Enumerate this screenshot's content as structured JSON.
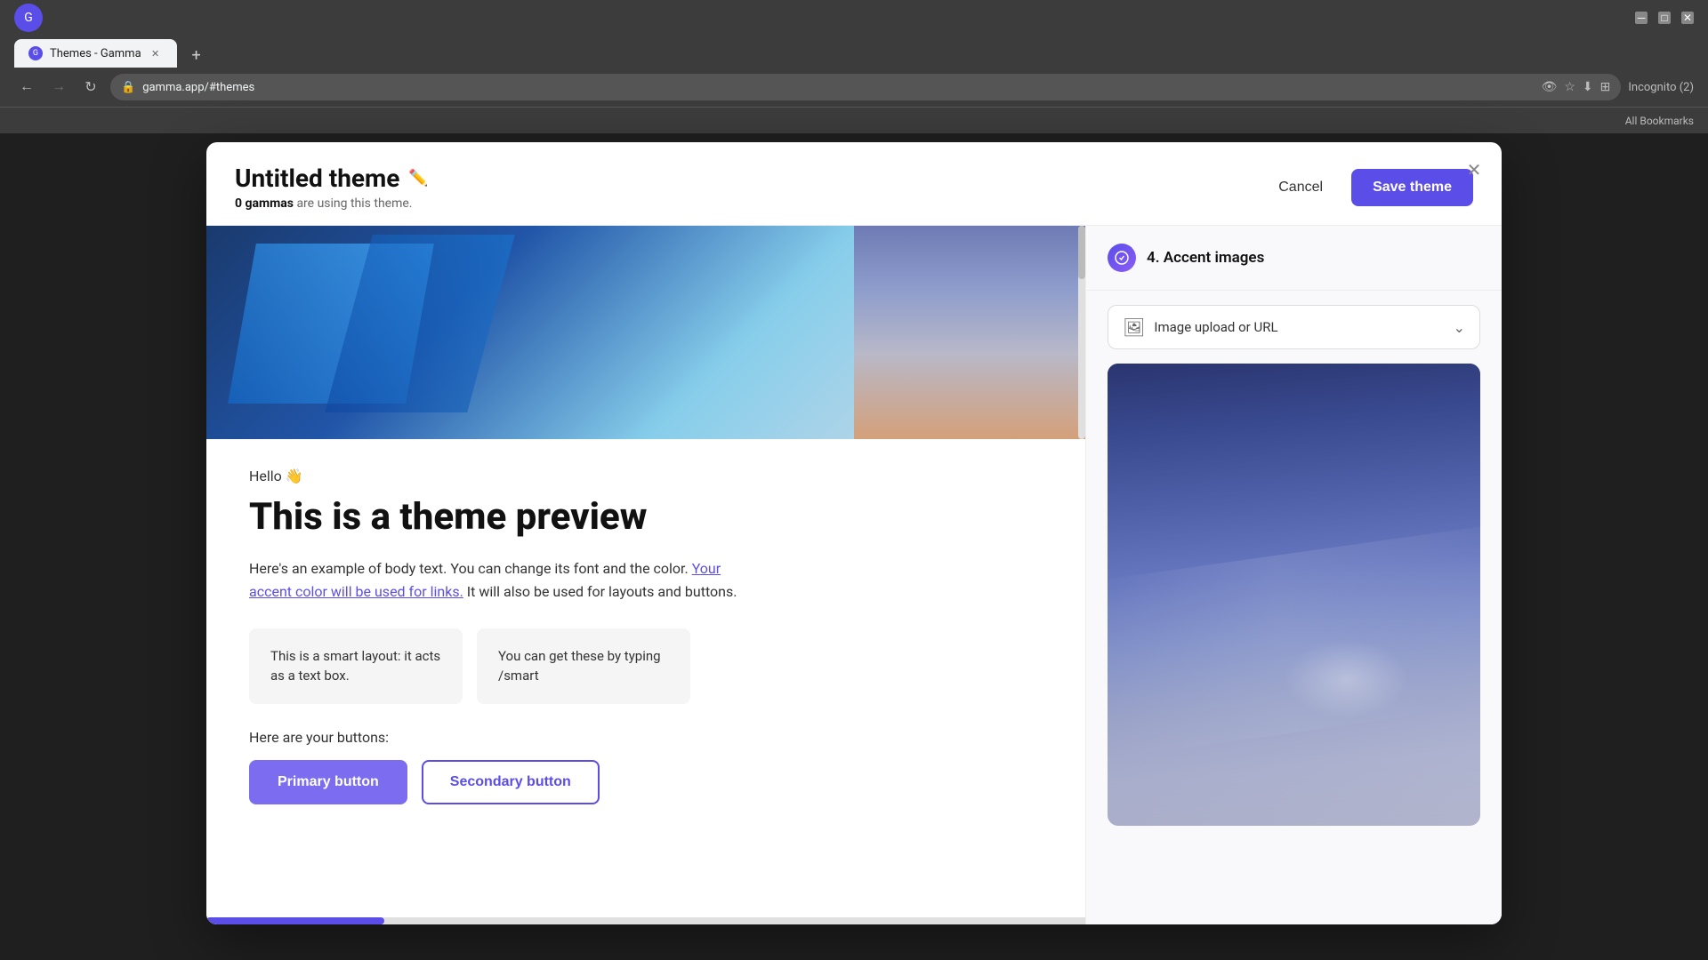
{
  "browser": {
    "tab_title": "Themes - Gamma",
    "url": "gamma.app/#themes",
    "add_tab_label": "+",
    "nav_back": "←",
    "nav_forward": "→",
    "nav_refresh": "↻",
    "bookmarks_label": "All Bookmarks",
    "incognito_label": "Incognito (2)"
  },
  "modal": {
    "title": "Untitled theme",
    "subtitle_count": "0 gammas",
    "subtitle_text": " are using this theme.",
    "cancel_label": "Cancel",
    "save_label": "Save theme",
    "close_label": "✕"
  },
  "preview": {
    "greeting": "Hello 👋",
    "heading": "This is a theme preview",
    "body_text": "Here's an example of body text. You can change its font and the color.",
    "link_text": "Your accent color will be used for links.",
    "body_text2": " It will also be used for layouts and buttons.",
    "smart_box1": "This is a smart layout: it acts as a text box.",
    "smart_box2": "You can get these by typing /smart",
    "buttons_label": "Here are your buttons:",
    "primary_button": "Primary button",
    "secondary_button": "Secondary button"
  },
  "right_panel": {
    "section_number": "4.",
    "section_title": "Accent images",
    "image_upload_label": "Image upload or URL",
    "chevron": "⌄"
  }
}
